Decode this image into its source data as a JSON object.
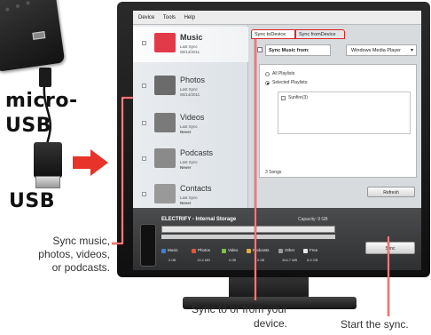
{
  "labels": {
    "micro_usb": "micro-\nUSB",
    "usb": "USB"
  },
  "app": {
    "menu": [
      "Device",
      "Tools",
      "Help"
    ],
    "sidebar": [
      {
        "title": "Music",
        "sub1": "Last Sync",
        "sub2": "06/14/2011",
        "selected": true,
        "thumb_color": "#e33a4a"
      },
      {
        "title": "Photos",
        "sub1": "Last Sync",
        "sub2": "06/14/2011",
        "selected": false,
        "thumb_color": "#6b6b6b"
      },
      {
        "title": "Videos",
        "sub1": "Last Sync",
        "sub2": "Never",
        "selected": false,
        "thumb_color": "#7a7a7a"
      },
      {
        "title": "Podcasts",
        "sub1": "Last Sync",
        "sub2": "Never",
        "selected": false,
        "thumb_color": "#8a8a8a"
      },
      {
        "title": "Contacts",
        "sub1": "Last Sync",
        "sub2": "Never",
        "selected": false,
        "thumb_color": "#999999"
      }
    ],
    "tabs": {
      "to": "Sync toDevice",
      "from": "Sync fromDevice"
    },
    "sync_from_label": "Sync Music from:",
    "source": "Windows Media Player",
    "all_playlists": "All Playlists",
    "selected_playlists": "Selected Playlists:",
    "playlist_item": "Sunfire(3)",
    "songs": "3 Songs",
    "refresh": "Refresh",
    "storage_title": "ELECTRIFY - Internal Storage",
    "capacity": "Capacity: 9 GB",
    "legend": [
      {
        "name": "Music",
        "value": "0.0B",
        "color": "#3f7fd1"
      },
      {
        "name": "Photos",
        "value": "13.4 MB",
        "color": "#e0553a"
      },
      {
        "name": "Video",
        "value": "0.0B",
        "color": "#7cc243"
      },
      {
        "name": "Podcasts",
        "value": "0.0B",
        "color": "#d6b33a"
      },
      {
        "name": "Other",
        "value": "454.7 MB",
        "color": "#9a9a9a"
      },
      {
        "name": "Free",
        "value": "8.5 GB",
        "color": "#e8e8e8"
      }
    ],
    "sync": "Sync"
  },
  "callouts": {
    "media": "Sync music,\nphotos, videos,\nor podcasts.",
    "tabs": "Sync to or from your\ndevice.",
    "start": "Start the sync."
  },
  "colors": {
    "accent_red": "#d9262b",
    "arrow_red": "#e8332a"
  }
}
